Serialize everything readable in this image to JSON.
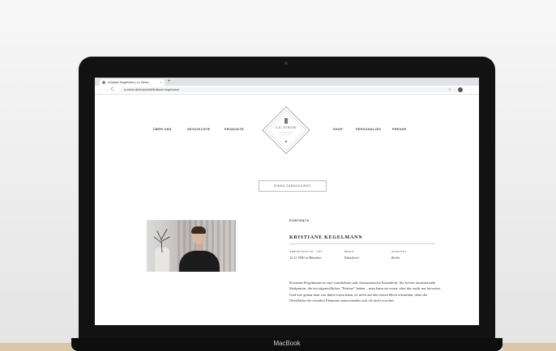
{
  "browser": {
    "tab_title": "Kristiane Kegelmann | Lu Sinoe...",
    "tab_close": "×",
    "new_tab": "+",
    "back": "←",
    "forward": "→",
    "reload": "C",
    "url": "lu-sinoe.de/en/portrait/kristiane-kegelmann",
    "star": "☆",
    "menu": "⋮"
  },
  "site": {
    "nav_left": [
      "ÜBER UNS",
      "GESCHICHTE",
      "PRODUKTE"
    ],
    "nav_right": [
      "SHOP",
      "PERSONALIES",
      "PRESSE"
    ],
    "logo_text": "LU SINOE",
    "cta": "EINEN ZURÜCKZIEHT"
  },
  "profile": {
    "section": "PORTRÄTS",
    "name": "KRISTIANE KEGELMANN",
    "meta": [
      {
        "label": "GEBURTSDATUM · ORT",
        "value": "12.11.1990 in München"
      },
      {
        "label": "BERUF",
        "value": "Künstlerin"
      },
      {
        "label": "WOHNORT",
        "value": "Berlin"
      }
    ],
    "bio": "Kristiane Kegelmann ist eine wunderbare und charismatische Künstlerin. Sie kreiert faszinierende Skulpturen, die ein eigenwilliches \"Feature\" haben – man kann sie essen, aber das sucht nur beiweise. Und was genau man von ihnen essen kann, ist nicht auf den ersten Blick erkennbar, denn die Oberfläche der sozialen Elemente unterscheidet sich oft nicht von den"
  },
  "device": {
    "brand": "MacBook"
  }
}
